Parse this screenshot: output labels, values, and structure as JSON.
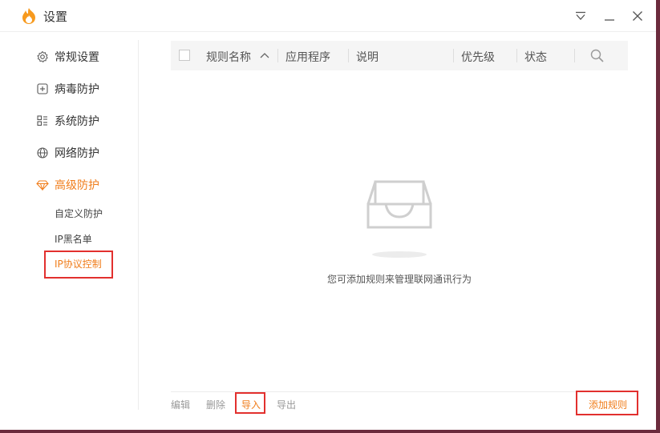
{
  "window": {
    "title": "设置"
  },
  "colors": {
    "accent": "#f07d1b",
    "highlight": "#e2302e"
  },
  "sidebar": {
    "items": [
      {
        "label": "常规设置",
        "icon": "gear-icon"
      },
      {
        "label": "病毒防护",
        "icon": "plus-box-icon"
      },
      {
        "label": "系统防护",
        "icon": "grid-icon"
      },
      {
        "label": "网络防护",
        "icon": "globe-icon"
      },
      {
        "label": "高级防护",
        "icon": "diamond-icon",
        "active": true
      }
    ],
    "sub_items": [
      {
        "label": "自定义防护"
      },
      {
        "label": "IP黑名单"
      },
      {
        "label": "IP协议控制",
        "active": true
      }
    ]
  },
  "table": {
    "columns": [
      "规则名称",
      "应用程序",
      "说明",
      "优先级",
      "状态"
    ],
    "sort_column": "规则名称",
    "sort_direction": "ascending"
  },
  "empty_state": {
    "message": "您可添加规则来管理联网通讯行为"
  },
  "footer": {
    "edit": "编辑",
    "delete": "删除",
    "import": "导入",
    "export": "导出",
    "add_rule": "添加规则"
  }
}
